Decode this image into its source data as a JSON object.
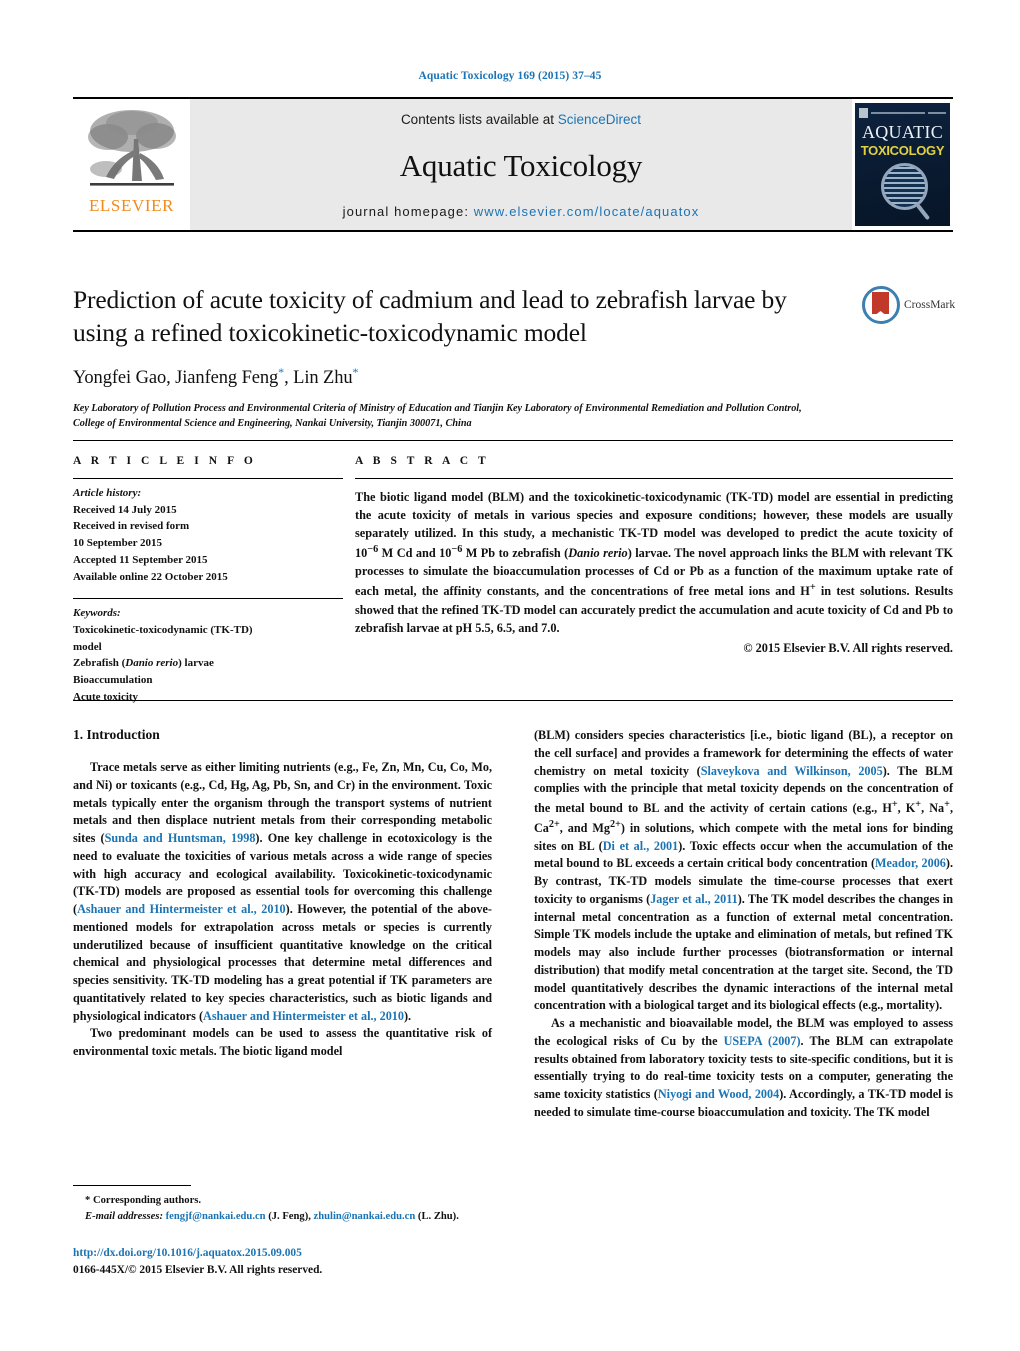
{
  "running_head": "Aquatic Toxicology 169 (2015) 37–45",
  "masthead": {
    "publisher_name": "ELSEVIER",
    "contents_prefix": "Contents lists available at ",
    "contents_link": "ScienceDirect",
    "journal_title": "Aquatic Toxicology",
    "homepage_prefix": "journal homepage: ",
    "homepage_url": "www.elsevier.com/locate/aquatox",
    "cover": {
      "line1": "AQUATIC",
      "line2": "TOXICOLOGY"
    }
  },
  "crossmark": {
    "label": "CrossMark"
  },
  "title": "Prediction of acute toxicity of cadmium and lead to zebrafish larvae by using a refined toxicokinetic-toxicodynamic model",
  "authors": "Yongfei Gao, Jianfeng Feng, Lin Zhu",
  "affiliation": "Key Laboratory of Pollution Process and Environmental Criteria of Ministry of Education and Tianjin Key Laboratory of Environmental Remediation and Pollution Control, College of Environmental Science and Engineering, Nankai University, Tianjin 300071, China",
  "article_info": {
    "heading": "A R T I C L E   I N F O",
    "history_label": "Article history:",
    "history": [
      "Received 14 July 2015",
      "Received in revised form",
      "10 September 2015",
      "Accepted 11 September 2015",
      "Available online 22 October 2015"
    ],
    "keywords_label": "Keywords:",
    "keywords": [
      "Toxicokinetic-toxicodynamic (TK-TD)",
      "model",
      "Zebrafish (Danio rerio) larvae",
      "Bioaccumulation",
      "Acute toxicity"
    ],
    "keyword_italic": "Danio rerio"
  },
  "abstract": {
    "heading": "A B S T R A C T",
    "text": "The biotic ligand model (BLM) and the toxicokinetic-toxicodynamic (TK-TD) model are essential in predicting the acute toxicity of metals in various species and exposure conditions; however, these models are usually separately utilized. In this study, a mechanistic TK-TD model was developed to predict the acute toxicity of 10−6 M Cd and 10−6 M Pb to zebrafish (Danio rerio) larvae. The novel approach links the BLM with relevant TK processes to simulate the bioaccumulation processes of Cd or Pb as a function of the maximum uptake rate of each metal, the affinity constants, and the concentrations of free metal ions and H+ in test solutions. Results showed that the refined TK-TD model can accurately predict the accumulation and acute toxicity of Cd and Pb to zebrafish larvae at pH 5.5, 6.5, and 7.0.",
    "copyright": "© 2015 Elsevier B.V. All rights reserved."
  },
  "body": {
    "section_heading": "1.  Introduction",
    "left_paragraphs": [
      "Trace metals serve as either limiting nutrients (e.g., Fe, Zn, Mn, Cu, Co, Mo, and Ni) or toxicants (e.g., Cd, Hg, Ag, Pb, Sn, and Cr) in the environment. Toxic metals typically enter the organism through the transport systems of nutrient metals and then displace nutrient metals from their corresponding metabolic sites (Sunda and Huntsman, 1998). One key challenge in ecotoxicology is the need to evaluate the toxicities of various metals across a wide range of species with high accuracy and ecological availability. Toxicokinetic-toxicodynamic (TK-TD) models are proposed as essential tools for overcoming this challenge (Ashauer and Hintermeister et al., 2010). However, the potential of the above-mentioned models for extrapolation across metals or species is currently underutilized because of insufficient quantitative knowledge on the critical chemical and physiological processes that determine metal differences and species sensitivity. TK-TD modeling has a great potential if TK parameters are quantitatively related to key species characteristics, such as biotic ligands and physiological indicators (Ashauer and Hintermeister et al., 2010).",
      "Two predominant models can be used to assess the quantitative risk of environmental toxic metals. The biotic ligand model"
    ],
    "right_paragraphs": [
      "(BLM) considers species characteristics [i.e., biotic ligand (BL), a receptor on the cell surface] and provides a framework for determining the effects of water chemistry on metal toxicity (Slaveykova and Wilkinson, 2005). The BLM complies with the principle that metal toxicity depends on the concentration of the metal bound to BL and the activity of certain cations (e.g., H+, K+, Na+, Ca2+, and Mg2+) in solutions, which compete with the metal ions for binding sites on BL (Di et al., 2001). Toxic effects occur when the accumulation of the metal bound to BL exceeds a certain critical body concentration (Meador, 2006). By contrast, TK-TD models simulate the time-course processes that exert toxicity to organisms (Jager et al., 2011). The TK model describes the changes in internal metal concentration as a function of external metal concentration. Simple TK models include the uptake and elimination of metals, but refined TK models may also include further processes (biotransformation or internal distribution) that modify metal concentration at the target site. Second, the TD model quantitatively describes the dynamic interactions of the internal metal concentration with a biological target and its biological effects (e.g., mortality).",
      "As a mechanistic and bioavailable model, the BLM was employed to assess the ecological risks of Cu by the USEPA (2007). The BLM can extrapolate results obtained from laboratory toxicity tests to site-specific conditions, but it is essentially trying to do real-time toxicity tests on a computer, generating the same toxicity statistics (Niyogi and Wood, 2004). Accordingly, a TK-TD model is needed to simulate time-course bioaccumulation and toxicity. The TK model"
    ],
    "references_cited": [
      "Sunda and Huntsman, 1998",
      "Ashauer and Hintermeister et al., 2010",
      "Slaveykova and Wilkinson, 2005",
      "Di et al., 2001",
      "Meador, 2006",
      "Jager et al., 2011",
      "USEPA (2007)",
      "Niyogi and Wood, 2004"
    ]
  },
  "footnote": {
    "corresponding": "*  Corresponding authors.",
    "email_label": "E-mail addresses:",
    "email1": "fengjf@nankai.edu.cn",
    "email1_owner": "(J. Feng),",
    "email2": "zhulin@nankai.edu.cn",
    "email2_owner": "(L. Zhu)."
  },
  "footer": {
    "doi": "http://dx.doi.org/10.1016/j.aquatox.2015.09.005",
    "issn": "0166-445X/© 2015 Elsevier B.V. All rights reserved."
  },
  "colors": {
    "link": "#1b74b4",
    "elsevier_orange": "#F08A1D",
    "masthead_bg": "#e9e9e9"
  }
}
